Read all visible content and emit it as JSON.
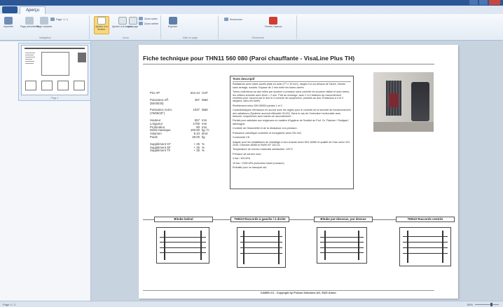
{
  "app": {
    "ribbon_tab": "Aperçu",
    "colors": {
      "titlebar": "#2b5797",
      "ribbon_bg": "#e3ebf4",
      "viewer_bg": "#c8d3e0",
      "highlight": "#f9d778",
      "close_red": "#d23b2f"
    }
  },
  "ribbon": {
    "groups": [
      {
        "label": "Navigation"
      },
      {
        "label": "Zoom"
      },
      {
        "label": "Mise en page"
      },
      {
        "label": "Recherche"
      }
    ],
    "buttons": [
      {
        "label": "Imprimer",
        "icon": "print-icon"
      },
      {
        "label": "Page précédente",
        "icon": "prev-page-icon"
      },
      {
        "label": "Page suivante",
        "icon": "next-page-icon"
      },
      {
        "label": "Page: 1 / 1",
        "icon": "page-icon"
      },
      {
        "label": "Ajuster à la fenêtre",
        "icon": "fit-window-icon"
      },
      {
        "label": "Ajuster à la largeur",
        "icon": "fit-width-icon"
      },
      {
        "label": "Une page",
        "icon": "one-page-icon"
      },
      {
        "label": "Zoom avant",
        "icon": "zoom-in-icon"
      },
      {
        "label": "Zoom arrière",
        "icon": "zoom-out-icon"
      },
      {
        "label": "Exporter",
        "icon": "export-icon"
      },
      {
        "label": "Rechercher",
        "icon": "search-icon"
      },
      {
        "label": "Fermer l'aperçu",
        "icon": "close-icon"
      }
    ]
  },
  "thumbnail": {
    "caption": "Page 1"
  },
  "page": {
    "title": "Fiche technique pour THN11 560 080 (Paroi chauffante - VisaLine Plus TH)",
    "specs": [
      {
        "k": "Prix AP",
        "v": "644.44",
        "u": "CHF"
      },
      {
        "gap": true
      },
      {
        "k": "Puissance eff.",
        "v": "467",
        "u": "Watt"
      },
      {
        "k": "(50/40/20)",
        "v": "",
        "u": ""
      },
      {
        "gap": true
      },
      {
        "k": "Puissance norm.",
        "v": "1037",
        "u": "Watt"
      },
      {
        "k": "(75/65/20°)",
        "v": "",
        "u": ""
      },
      {
        "gap": true
      },
      {
        "k": "Hauteur",
        "v": "557",
        "u": "mm"
      },
      {
        "k": "Longueur",
        "v": "1700",
        "u": "mm"
      },
      {
        "k": "Profondeur",
        "v": "80",
        "u": "mm"
      },
      {
        "k": "Débit massique",
        "v": "100.60",
        "u": "kg / h"
      },
      {
        "k": "Volumen",
        "v": "8.10",
        "u": "dm3"
      },
      {
        "k": "Poids",
        "v": "28.00",
        "u": "kg"
      },
      {
        "gap": true
      },
      {
        "k": "Supplément CF",
        "v": "+ 25",
        "u": "%"
      },
      {
        "k": "Supplément SF",
        "v": "+ 25",
        "u": "%"
      },
      {
        "k": "Supplément TF",
        "v": "+ 35",
        "u": "%"
      }
    ],
    "desc_header": "Texte descriptif",
    "desc_paragraphs": [
      "Radiateurs avec tubes carrés plats en acier (77 x 10 mm), rangés l'un au-dessus de l'autre, formés sans serrage, soudés. Espace de 2 mm entre les tubes carrés.",
      "Tubes collecteurs au dos reliés par soudure à pression sans contrôle de soudure visible et avec tubes, les orifices arrondis avec 8mm = 2 mm. Prêt au montage, avec 2 à 4 fixations de raccordement montées pour raccord par le dos et 4 console de suspension, produits au dos. Émissions à 4 et 2 rangées, sans les tubes.",
      "Revêtement selon DIN 55900 parties 1 et 2.",
      "Caractéristiques d'émission en accord avec les règles pour le contrôle de la sécurité de fonctionnement des radiateurs (Système acceroit efficacité G/U/S). Dans le cas de l'exécution horizontale avec tamoule, uniquement avec bande de raccordement ...",
      "Perfait pour satisfaire aux exigences en matière d'hygiène de l'Institut du Prof. Dr. Flatzner / Stuttgart / Allemagne.",
      "Contrôle de l'étanchéité et de la résistance à la pression.",
      "Puissance calorifique contrôlée et enregistrée selon EN 442.",
      "Conformité CE.",
      "Adapté pour les installations de chauffage à eau chaude selon DIN 18380 et qualité de l'eau selon VDI 2035. Directive 85/85 et SWKI BT 102-01.",
      "Température de service maximale admissible: 120°C",
      "Pression de service max.:",
      "4 bar / 400 kPa",
      "10 bar / 1000 kPa (exécution haute pression)",
      "Emballé pour un transport sûr."
    ],
    "diagram_labels": [
      "Bitube latéral",
      "THN10 Raccords à gauche / à droite",
      "Bitube par-dessous, par dessus",
      "THN10 Raccords centrés"
    ],
    "footer": "KAWIN 2.6 - Copyright by Probus Solutions AG, 9320 Arbon"
  },
  "status": {
    "left": "Page 1 / 1",
    "zoom": "85%"
  }
}
